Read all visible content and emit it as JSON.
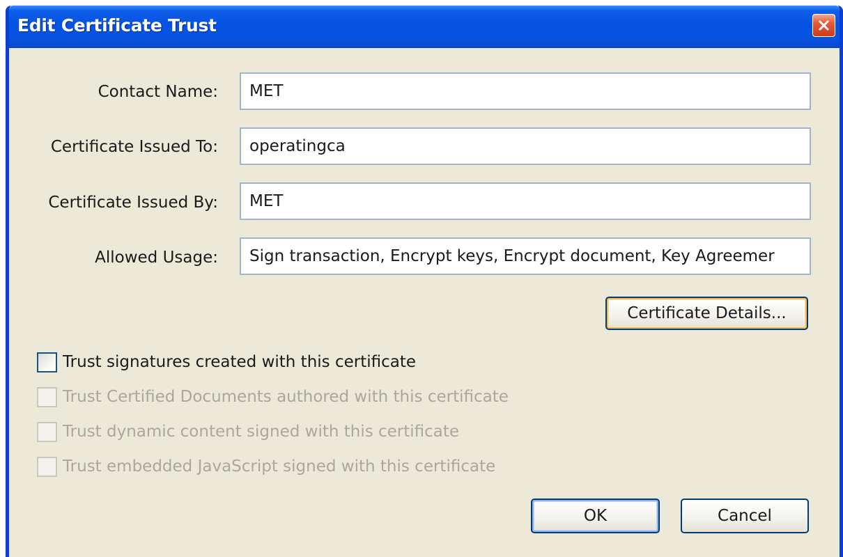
{
  "window": {
    "title": "Edit Certificate Trust",
    "close_icon": "close-icon"
  },
  "fields": [
    {
      "label": "Contact Name:",
      "value": "MET"
    },
    {
      "label": "Certificate Issued To:",
      "value": "operatingca"
    },
    {
      "label": "Certificate Issued By:",
      "value": "MET"
    },
    {
      "label": "Allowed Usage:",
      "value": "Sign transaction, Encrypt keys, Encrypt document, Key Agreemer"
    }
  ],
  "buttons": {
    "details": "Certificate Details...",
    "ok": "OK",
    "cancel": "Cancel"
  },
  "checkboxes": [
    {
      "label": "Trust signatures created with this certificate",
      "checked": false,
      "enabled": true
    },
    {
      "label": "Trust Certified Documents authored with this certificate",
      "checked": false,
      "enabled": false
    },
    {
      "label": "Trust dynamic content signed with this certificate",
      "checked": false,
      "enabled": false
    },
    {
      "label": "Trust embedded JavaScript signed with this certificate",
      "checked": false,
      "enabled": false
    }
  ],
  "colors": {
    "titlebar": "#0553e2",
    "dialog_background": "#ece9d8",
    "close_button": "#e3593a",
    "disabled_text": "#aca899"
  }
}
